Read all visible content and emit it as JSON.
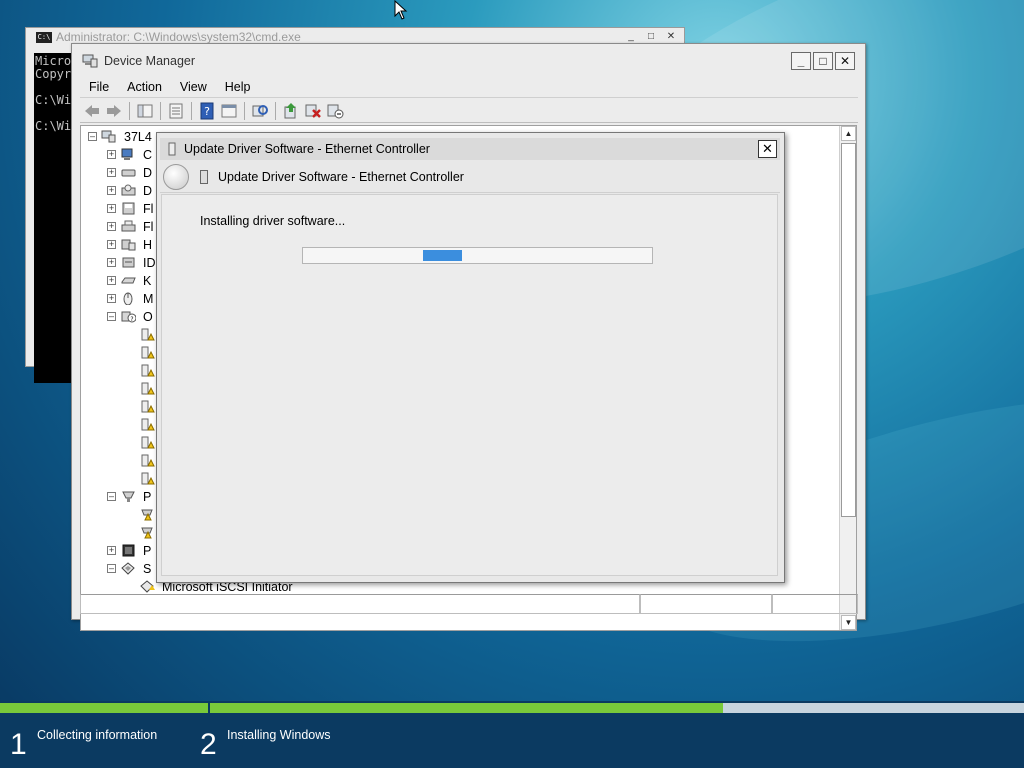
{
  "cmd": {
    "title": "Administrator: C:\\Windows\\system32\\cmd.exe",
    "lines": "Micro\nCopyr\n\nC:\\Wi\n\nC:\\Wi"
  },
  "device_manager": {
    "title": "Device Manager",
    "menu": [
      "File",
      "Action",
      "View",
      "Help"
    ],
    "tree": {
      "root": "37L4",
      "partial_labels": [
        "C",
        "D",
        "D",
        "Fl",
        "Fl",
        "H",
        "ID",
        "K",
        "M",
        "O",
        "P",
        "P",
        "S"
      ],
      "last_item": "Microsoft iSCSI Initiator"
    }
  },
  "dialog": {
    "title": "Update Driver Software - Ethernet Controller",
    "header": "Update Driver Software - Ethernet Controller",
    "message": "Installing driver software...",
    "progress_fraction": 0.4
  },
  "setup": {
    "steps": [
      {
        "number": "1",
        "label": "Collecting information",
        "progress": 1.0
      },
      {
        "number": "2",
        "label": "Installing Windows",
        "progress": 0.63
      }
    ]
  },
  "colors": {
    "progress_blue": "#3b8ede",
    "setup_green": "#79c93a",
    "setup_bg": "#0b3a61"
  }
}
